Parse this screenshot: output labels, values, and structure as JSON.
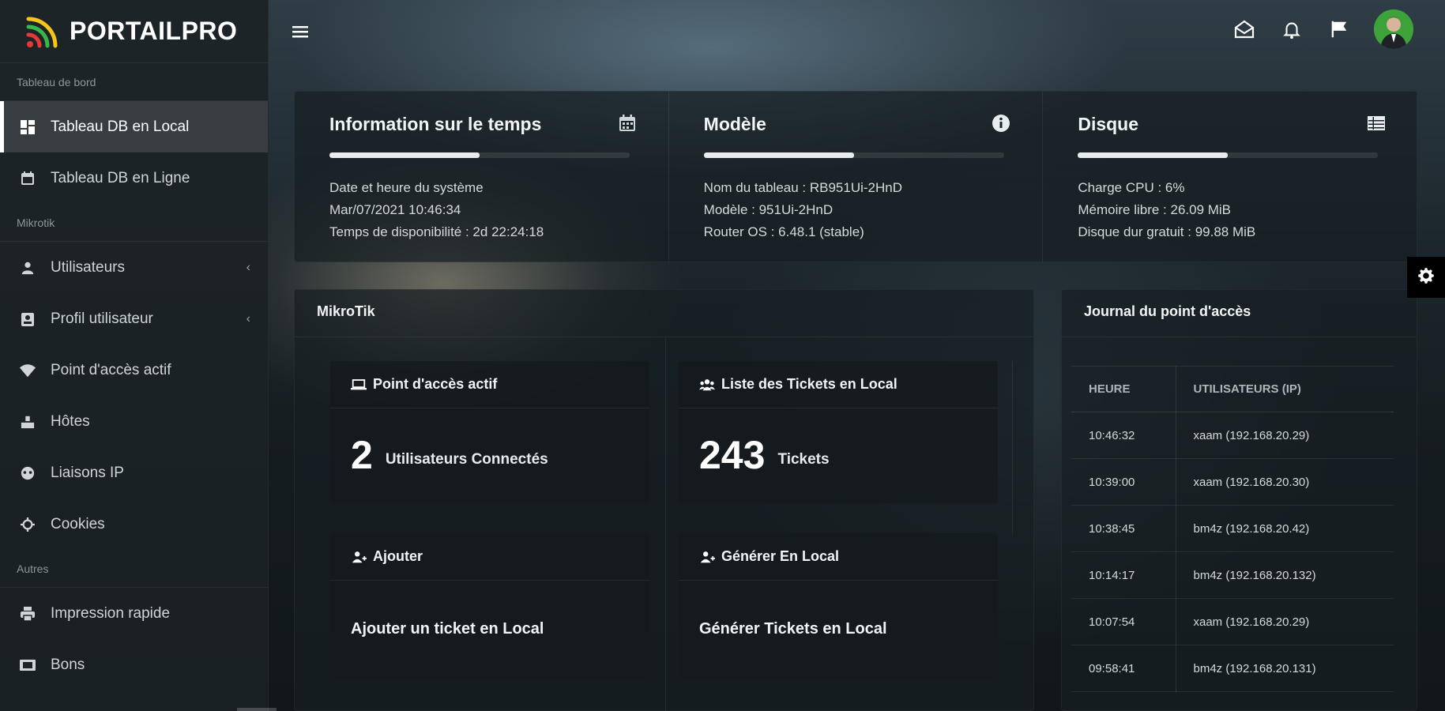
{
  "brand": {
    "name": "PORTAILPRO",
    "logo_icon": "wifi-signal-logo"
  },
  "sidebar": {
    "sections": [
      {
        "title": "Tableau de bord",
        "items": [
          {
            "label": "Tableau DB en Local",
            "icon": "dashboard-icon",
            "active": true
          },
          {
            "label": "Tableau DB en Ligne",
            "icon": "calendar-icon"
          }
        ]
      },
      {
        "title": "Mikrotik",
        "items": [
          {
            "label": "Utilisateurs",
            "icon": "user-icon",
            "chevron": "‹"
          },
          {
            "label": "Profil utilisateur",
            "icon": "id-card-icon",
            "chevron": "‹"
          },
          {
            "label": "Point d'accès actif",
            "icon": "wifi-icon"
          },
          {
            "label": "Hôtes",
            "icon": "hosts-icon"
          },
          {
            "label": "Liaisons IP",
            "icon": "link-icon"
          },
          {
            "label": "Cookies",
            "icon": "cookie-icon"
          }
        ]
      },
      {
        "title": "Autres",
        "items": [
          {
            "label": "Impression rapide",
            "icon": "printer-icon"
          },
          {
            "label": "Bons",
            "icon": "ticket-icon"
          }
        ]
      }
    ]
  },
  "topbar": {
    "icons": [
      "envelope-open-icon",
      "bell-icon",
      "flag-icon"
    ],
    "avatar": "user-avatar"
  },
  "info": {
    "time": {
      "title": "Information sur le temps",
      "icon": "calendar-icon",
      "progress": 0.5,
      "lines": [
        "Date et heure du système",
        "Mar/07/2021 10:46:34",
        "Temps de disponibilité : 2d 22:24:18"
      ]
    },
    "model": {
      "title": "Modèle",
      "icon": "info-circle-icon",
      "progress": 0.5,
      "lines": [
        "Nom du tableau : RB951Ui-2HnD",
        "Modèle : 951Ui-2HnD",
        "Router OS : 6.48.1 (stable)"
      ]
    },
    "disk": {
      "title": "Disque",
      "icon": "table-icon",
      "progress": 0.5,
      "lines": [
        "Charge CPU : 6%",
        "Mémoire libre : 26.09 MiB",
        "Disque dur gratuit : 99.88 MiB"
      ]
    }
  },
  "mikrotik": {
    "title": "MikroTik",
    "active_hotspot": {
      "title": "Point d'accès actif",
      "count": "2",
      "label": "Utilisateurs Connectés"
    },
    "tickets": {
      "title": "Liste des Tickets en Local",
      "count": "243",
      "label": "Tickets"
    },
    "add": {
      "title": "Ajouter",
      "link": "Ajouter un ticket en Local"
    },
    "generate": {
      "title": "Générer En Local",
      "link": "Générer Tickets en Local"
    }
  },
  "journal": {
    "title": "Journal du point d'accès",
    "headers": [
      "HEURE",
      "UTILISATEURS (IP)"
    ],
    "rows": [
      [
        "10:46:32",
        "xaam (192.168.20.29)"
      ],
      [
        "10:39:00",
        "xaam (192.168.20.30)"
      ],
      [
        "10:38:45",
        "bm4z (192.168.20.42)"
      ],
      [
        "10:14:17",
        "bm4z (192.168.20.132)"
      ],
      [
        "10:07:54",
        "xaam (192.168.20.29)"
      ],
      [
        "09:58:41",
        "bm4z (192.168.20.131)"
      ]
    ]
  }
}
